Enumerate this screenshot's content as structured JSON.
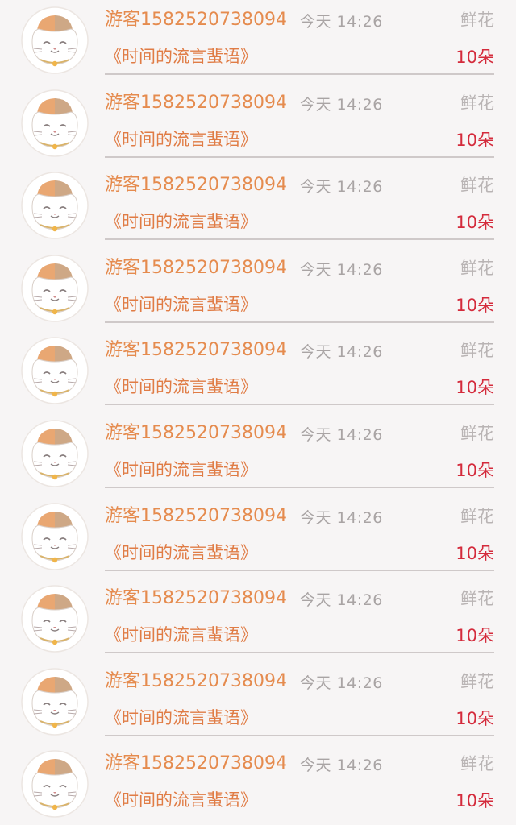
{
  "gift_list": {
    "rows": [
      {
        "user": "游客1582520738094",
        "time": "今天  14:26",
        "gift": "鲜花",
        "book": "《时间的流言蜚语》",
        "count": "10朵"
      },
      {
        "user": "游客1582520738094",
        "time": "今天  14:26",
        "gift": "鲜花",
        "book": "《时间的流言蜚语》",
        "count": "10朵"
      },
      {
        "user": "游客1582520738094",
        "time": "今天  14:26",
        "gift": "鲜花",
        "book": "《时间的流言蜚语》",
        "count": "10朵"
      },
      {
        "user": "游客1582520738094",
        "time": "今天  14:26",
        "gift": "鲜花",
        "book": "《时间的流言蜚语》",
        "count": "10朵"
      },
      {
        "user": "游客1582520738094",
        "time": "今天  14:26",
        "gift": "鲜花",
        "book": "《时间的流言蜚语》",
        "count": "10朵"
      },
      {
        "user": "游客1582520738094",
        "time": "今天  14:26",
        "gift": "鲜花",
        "book": "《时间的流言蜚语》",
        "count": "10朵"
      },
      {
        "user": "游客1582520738094",
        "time": "今天  14:26",
        "gift": "鲜花",
        "book": "《时间的流言蜚语》",
        "count": "10朵"
      },
      {
        "user": "游客1582520738094",
        "time": "今天  14:26",
        "gift": "鲜花",
        "book": "《时间的流言蜚语》",
        "count": "10朵"
      },
      {
        "user": "游客1582520738094",
        "time": "今天  14:26",
        "gift": "鲜花",
        "book": "《时间的流言蜚语》",
        "count": "10朵"
      },
      {
        "user": "游客1582520738094",
        "time": "今天  14:26",
        "gift": "鲜花",
        "book": "《时间的流言蜚语》",
        "count": "10朵"
      }
    ],
    "avatar_icon": "lucky-cat-icon",
    "colors": {
      "background": "#f7f5f5",
      "user_name": "#e58b4e",
      "time": "#a9a4a4",
      "gift": "#b9b4b4",
      "book": "#e07c45",
      "count": "#d42b3c",
      "divider": "#cfc9c9"
    }
  }
}
